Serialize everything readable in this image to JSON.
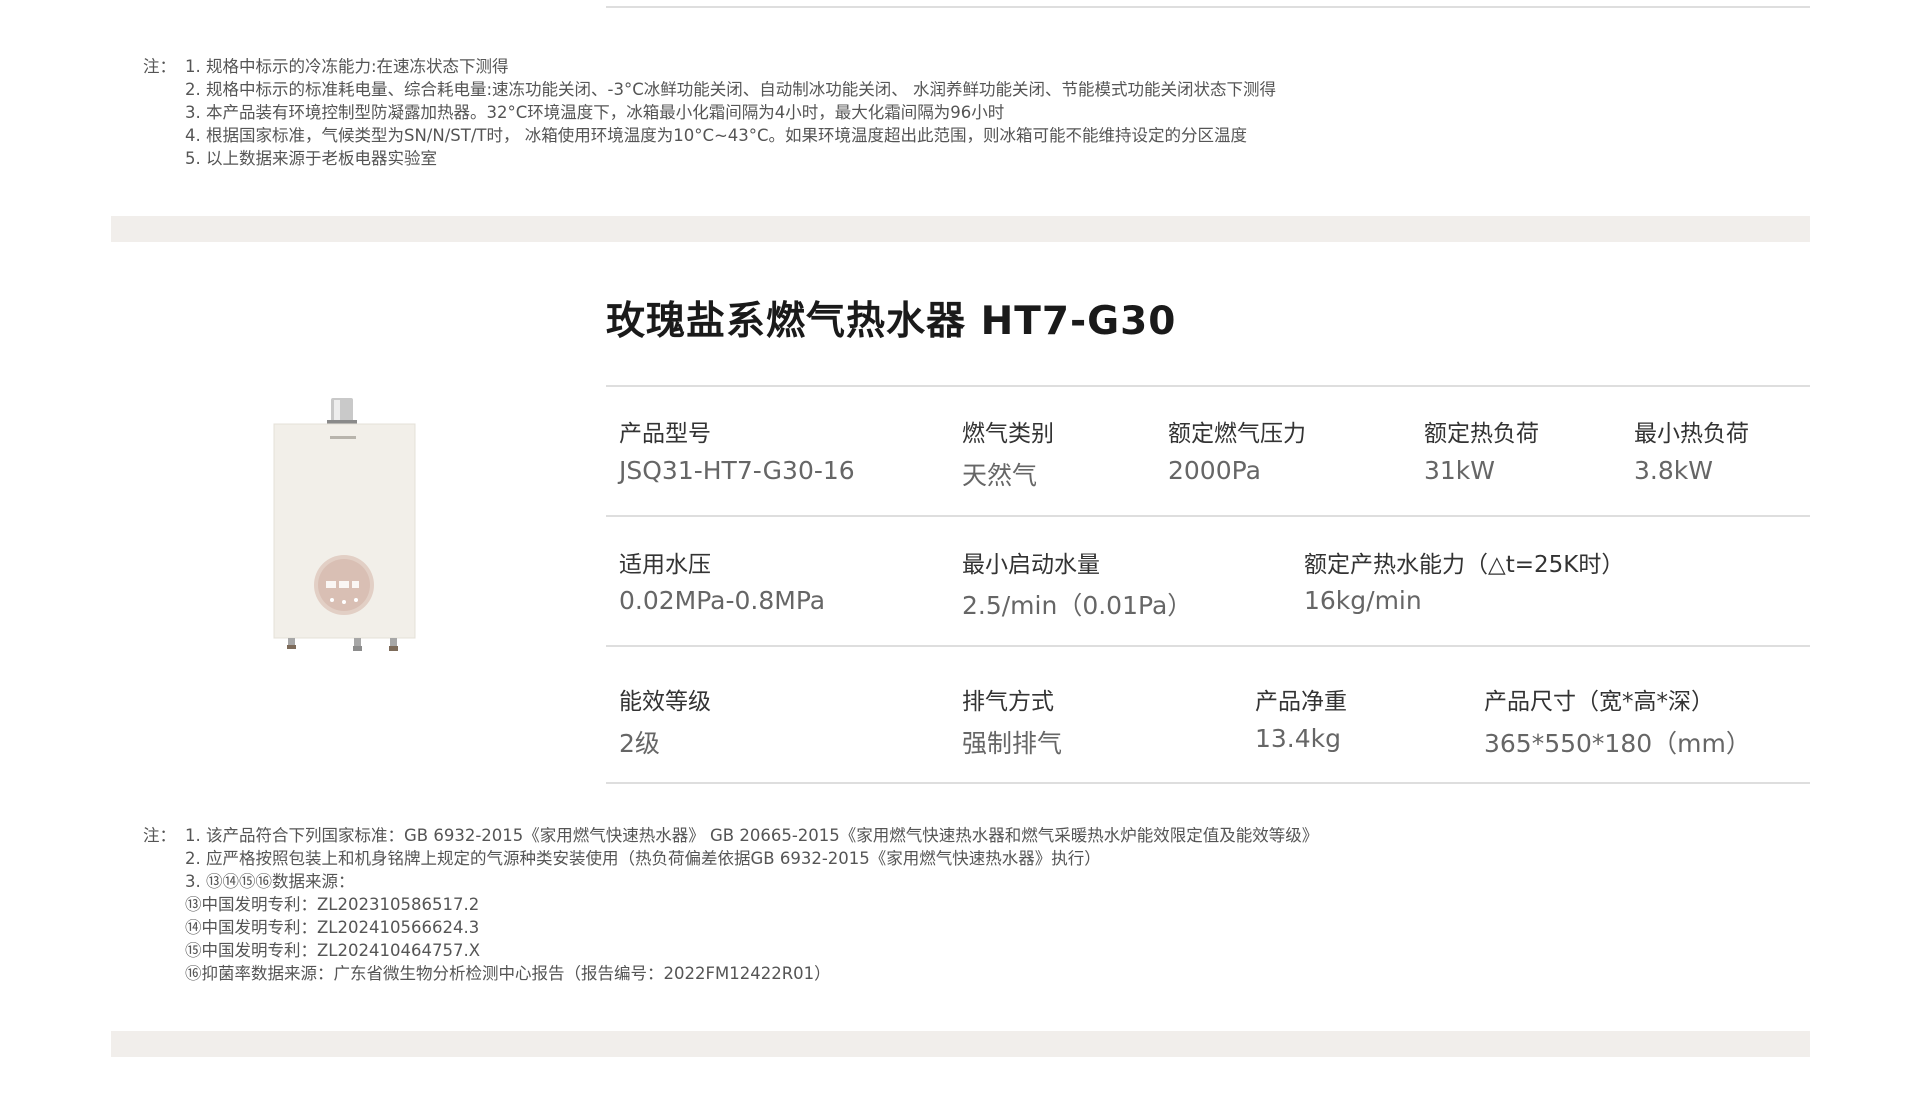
{
  "top_notes": {
    "label": "注：",
    "items": [
      "1. 规格中标示的冷冻能力:在速冻状态下测得",
      "2. 规格中标示的标准耗电量、综合耗电量:速冻功能关闭、-3°C冰鲜功能关闭、自动制冰功能关闭、 水润养鲜功能关闭、节能模式功能关闭状态下测得",
      "3. 本产品装有环境控制型防凝露加热器。32°C环境温度下，冰箱最小化霜间隔为4小时，最大化霜间隔为96小时",
      "4. 根据国家标准，气候类型为SN/N/ST/T时， 冰箱使用环境温度为10°C~43°C。如果环境温度超出此范围，则冰箱可能不能维持设定的分区温度",
      "5. 以上数据来源于老板电器实验室"
    ]
  },
  "product": {
    "title": "玫瑰盐系燃气热水器 HT7-G30",
    "image_icon": "water-heater-image",
    "specs": [
      {
        "label": "产品型号",
        "value": "JSQ31-HT7-G30-16"
      },
      {
        "label": "燃气类别",
        "value": "天然气"
      },
      {
        "label": "额定燃气压力",
        "value": "2000Pa"
      },
      {
        "label": "额定热负荷",
        "value": "31kW"
      },
      {
        "label": "最小热负荷",
        "value": "3.8kW"
      },
      {
        "label": "适用水压",
        "value": "0.02MPa-0.8MPa"
      },
      {
        "label": "最小启动水量",
        "value": "2.5/min（0.01Pa）"
      },
      {
        "label": "额定产热水能力（△t=25K时）",
        "value": "16kg/min"
      },
      {
        "label": "能效等级",
        "value": "2级"
      },
      {
        "label": "排气方式",
        "value": "强制排气"
      },
      {
        "label": "产品净重",
        "value": "13.4kg"
      },
      {
        "label": "产品尺寸（宽*高*深）",
        "value": "365*550*180（mm）"
      }
    ]
  },
  "bottom_notes": {
    "label": "注：",
    "items": [
      "1. 该产品符合下列国家标准：GB 6932-2015《家用燃气快速热水器》          GB 20665-2015《家用燃气快速热水器和燃气采暖热水炉能效限定值及能效等级》",
      "2. 应严格按照包装上和机身铭牌上规定的气源种类安装使用（热负荷偏差依据GB 6932-2015《家用燃气快速热水器》执行）",
      "3. ⑬⑭⑮⑯数据来源：",
      "⑬中国发明专利：ZL202310586517.2",
      "⑭中国发明专利：ZL202410566624.3",
      "⑮中国发明专利：ZL202410464757.X",
      "⑯抑菌率数据来源：广东省微生物分析检测中心报告（报告编号：2022FM12422R01）"
    ]
  },
  "colors": {
    "band": "#f1eeeb",
    "divider": "#dedede",
    "title": "#1a1a1a",
    "product_body": "#f2efe9",
    "dial": "#d9bfb4"
  }
}
